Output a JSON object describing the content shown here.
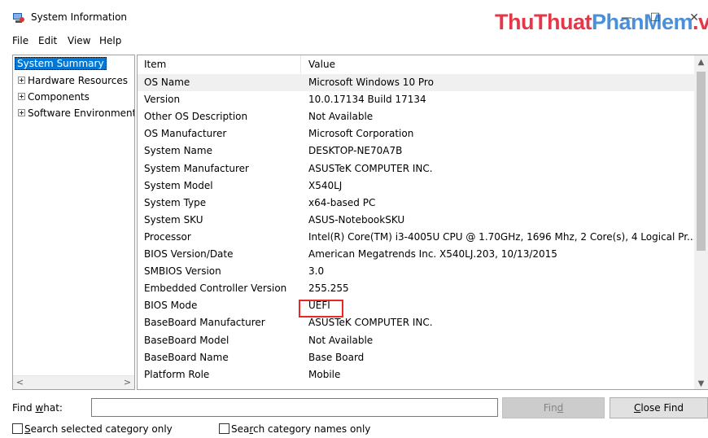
{
  "window": {
    "title": "System Information",
    "watermark_a": "ThuThuat",
    "watermark_b": "PhanMem",
    "watermark_c": ".vn",
    "minimize_glyph": "—",
    "maximize_glyph": "☐",
    "close_glyph": "✕"
  },
  "menu": [
    "File",
    "Edit",
    "View",
    "Help"
  ],
  "tree": {
    "root": "System Summary",
    "children": [
      "Hardware Resources",
      "Components",
      "Software Environment"
    ]
  },
  "details": {
    "columns": [
      "Item",
      "Value"
    ],
    "rows": [
      {
        "item": "OS Name",
        "value": "Microsoft Windows 10 Pro"
      },
      {
        "item": "Version",
        "value": "10.0.17134 Build 17134"
      },
      {
        "item": "Other OS Description",
        "value": "Not Available"
      },
      {
        "item": "OS Manufacturer",
        "value": "Microsoft Corporation"
      },
      {
        "item": "System Name",
        "value": "DESKTOP-NE70A7B"
      },
      {
        "item": "System Manufacturer",
        "value": "ASUSTeK COMPUTER INC."
      },
      {
        "item": "System Model",
        "value": "X540LJ"
      },
      {
        "item": "System Type",
        "value": "x64-based PC"
      },
      {
        "item": "System SKU",
        "value": "ASUS-NotebookSKU"
      },
      {
        "item": "Processor",
        "value": "Intel(R) Core(TM) i3-4005U CPU @ 1.70GHz, 1696 Mhz, 2 Core(s), 4 Logical Pr..."
      },
      {
        "item": "BIOS Version/Date",
        "value": "American Megatrends Inc. X540LJ.203, 10/13/2015"
      },
      {
        "item": "SMBIOS Version",
        "value": "3.0"
      },
      {
        "item": "Embedded Controller Version",
        "value": "255.255"
      },
      {
        "item": "BIOS Mode",
        "value": "UEFI"
      },
      {
        "item": "BaseBoard Manufacturer",
        "value": "ASUSTeK COMPUTER INC."
      },
      {
        "item": "BaseBoard Model",
        "value": "Not Available"
      },
      {
        "item": "BaseBoard Name",
        "value": "Base Board"
      },
      {
        "item": "Platform Role",
        "value": "Mobile"
      }
    ]
  },
  "find": {
    "label_prefix": "Find ",
    "label_u": "w",
    "label_suffix": "hat:",
    "input_value": "",
    "find_prefix": "Fin",
    "find_u": "d",
    "close_u": "C",
    "close_suffix": "lose Find",
    "chk1_u": "S",
    "chk1_suffix": "earch selected category only",
    "chk2_prefix": "Sea",
    "chk2_u": "r",
    "chk2_suffix": "ch category names only"
  },
  "colors": {
    "selection": "#0078d7",
    "highlight_border": "#e82727",
    "watermark_red": "#e4374a",
    "watermark_blue": "#4a90d9"
  },
  "icons": {
    "app": "system-information-icon",
    "expand": "plus-expander-icon"
  }
}
